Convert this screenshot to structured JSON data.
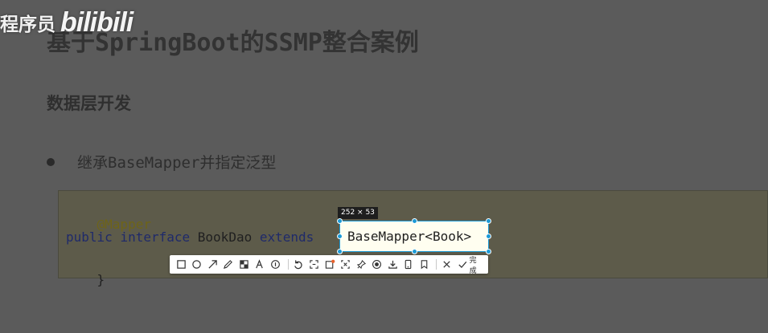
{
  "watermark": {
    "text": "程序员",
    "logo": "bilibili"
  },
  "slide": {
    "title": "基于SpringBoot的SSMP整合案例",
    "section": "数据层开发",
    "bullet": "继承BaseMapper并指定泛型"
  },
  "code": {
    "line1": "@Mapper",
    "line2_kw1": "public",
    "line2_kw2": "interface",
    "line2_id": "BookDao",
    "line2_kw3": "extends",
    "line2_tail": "{",
    "line3": "}"
  },
  "screenshot_tool": {
    "size_label": "252 × 53",
    "selected_text": "BaseMapper<Book>",
    "done_label": "完成",
    "tools": [
      "rectangle-icon",
      "ellipse-icon",
      "arrow-icon",
      "pen-icon",
      "mosaic-icon",
      "text-icon",
      "number-icon",
      "undo-icon",
      "ocr-icon",
      "translate-icon",
      "scroll-capture-icon",
      "pin-icon",
      "record-icon",
      "download-icon",
      "phone-icon",
      "bookmark-icon"
    ],
    "accent_color": "#1c9ad6"
  }
}
